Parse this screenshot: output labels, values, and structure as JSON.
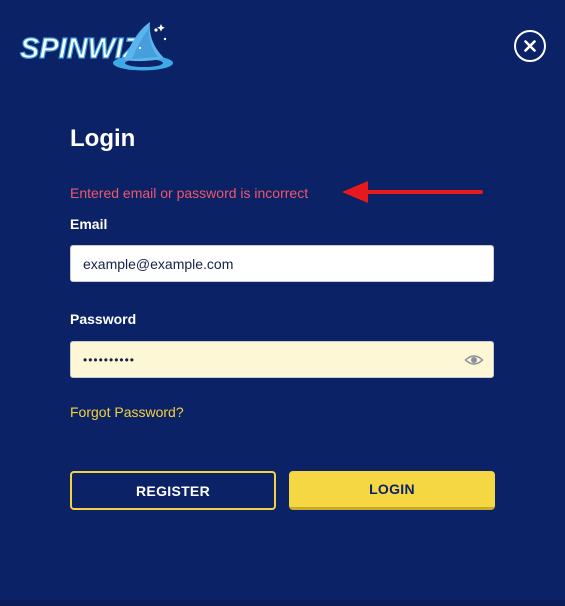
{
  "brand": {
    "logo_text": "SPINWIZ"
  },
  "header": {
    "close_label": "×"
  },
  "form": {
    "title": "Login",
    "error_message": "Entered email or password is incorrect",
    "email": {
      "label": "Email",
      "value": "example@example.com"
    },
    "password": {
      "label": "Password",
      "value": "••••••••••"
    },
    "forgot_link": "Forgot Password?",
    "register_label": "REGISTER",
    "login_label": "LOGIN"
  },
  "icons": {
    "close": "close-icon",
    "eye": "eye-icon",
    "arrow": "arrow-left-icon",
    "wizard_hat": "wizard-hat-icon"
  },
  "colors": {
    "background": "#0c2266",
    "accent_yellow": "#f5d743",
    "error_red": "#f0576a",
    "annotation_red": "#e8191b",
    "password_fill": "#fef7d5"
  }
}
